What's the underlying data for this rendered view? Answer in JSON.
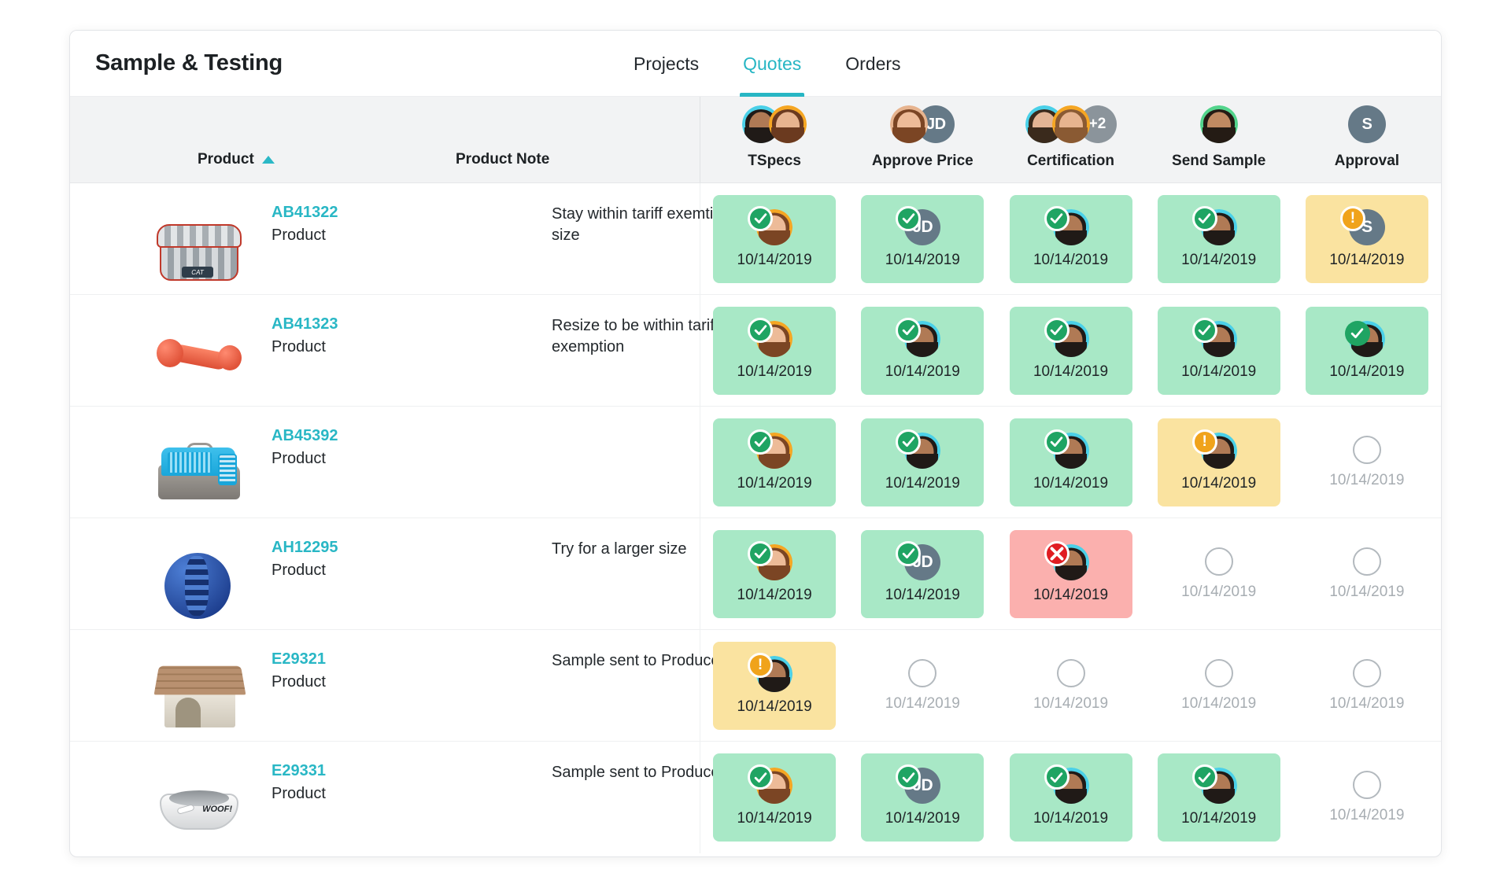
{
  "header": {
    "title": "Sample & Testing",
    "tabs": [
      {
        "label": "Projects",
        "active": false
      },
      {
        "label": "Quotes",
        "active": true
      },
      {
        "label": "Orders",
        "active": false
      }
    ]
  },
  "colors": {
    "accent": "#27b6c4",
    "link": "#29b7c5",
    "approved_bg": "#a8e8c6",
    "pending_bg": "#fae3a0",
    "rejected_bg": "#fbb0ae",
    "badge_ok": "#1fa463",
    "badge_warn": "#f0a31b",
    "badge_no": "#e01c22",
    "avatar_initials_bg": "#657987",
    "avatar_more_bg": "#8b949b",
    "header_bg": "#f2f3f4"
  },
  "table": {
    "left_columns": [
      {
        "label": "Product",
        "sort": "asc",
        "sort_icon": "triangle-up-icon"
      },
      {
        "label": "Product Note",
        "sort": null
      }
    ],
    "status_columns": [
      {
        "label": "TSpecs",
        "avatars": [
          {
            "type": "photo",
            "ring": "#4ad0e8",
            "hair": "#201a17",
            "skin": "#b07a55"
          },
          {
            "type": "photo",
            "ring": "#f5a623",
            "hair": "#6b3a1f",
            "skin": "#e7b48f"
          }
        ]
      },
      {
        "label": "Approve Price",
        "avatars": [
          {
            "type": "photo",
            "ring": "#e7b48f",
            "hair": "#7b4524",
            "skin": "#edbb98"
          },
          {
            "type": "initials",
            "text": "JD"
          }
        ]
      },
      {
        "label": "Certification",
        "avatars": [
          {
            "type": "photo",
            "ring": "#4ad0e8",
            "hair": "#3a2a1c",
            "skin": "#e3b595"
          },
          {
            "type": "photo",
            "ring": "#f5a623",
            "hair": "#8a5a33",
            "skin": "#e7b48f"
          },
          {
            "type": "more",
            "text": "+2"
          }
        ]
      },
      {
        "label": "Send Sample",
        "avatars": [
          {
            "type": "photo",
            "ring": "#53d48c",
            "hair": "#241b14",
            "skin": "#c08a62"
          }
        ]
      },
      {
        "label": "Approval",
        "avatars": [
          {
            "type": "initials",
            "text": "S"
          }
        ]
      }
    ],
    "rows": [
      {
        "thumb": "pet-bed-image",
        "thumb_label": "CAT",
        "code": "AB41322",
        "subtitle": "Product",
        "note": "Stay within tariff exemtion size",
        "menu_icon": "kebab-menu-icon",
        "cells": [
          {
            "state": "approved",
            "date": "10/14/2019",
            "badge": "check",
            "badge_hidden": false,
            "avatar": {
              "type": "photo",
              "ring": "#f5a623",
              "hair": "#7b4524",
              "skin": "#edbb98"
            }
          },
          {
            "state": "approved",
            "date": "10/14/2019",
            "badge": "check",
            "badge_hidden": false,
            "avatar": {
              "type": "initials",
              "text": "JD"
            }
          },
          {
            "state": "approved",
            "date": "10/14/2019",
            "badge": "check",
            "badge_hidden": false,
            "avatar": {
              "type": "photo",
              "ring": "#4ad0e8",
              "hair": "#201a17",
              "skin": "#b07a55"
            }
          },
          {
            "state": "approved",
            "date": "10/14/2019",
            "badge": "check",
            "badge_hidden": false,
            "avatar": {
              "type": "photo",
              "ring": "#4ad0e8",
              "hair": "#201a17",
              "skin": "#b07a55"
            }
          },
          {
            "state": "pending",
            "date": "10/14/2019",
            "badge": "warn",
            "badge_hidden": false,
            "avatar": {
              "type": "initials",
              "text": "S"
            }
          }
        ]
      },
      {
        "thumb": "dog-bone-toy-image",
        "thumb_label": "",
        "code": "AB41323",
        "subtitle": "Product",
        "note": "Resize to be within tariff exemption",
        "menu_icon": "kebab-menu-icon",
        "cells": [
          {
            "state": "approved",
            "date": "10/14/2019",
            "badge": "check",
            "badge_hidden": false,
            "avatar": {
              "type": "photo",
              "ring": "#f5a623",
              "hair": "#7b4524",
              "skin": "#edbb98"
            }
          },
          {
            "state": "approved",
            "date": "10/14/2019",
            "badge": "check",
            "badge_hidden": false,
            "avatar": {
              "type": "photo",
              "ring": "#4ad0e8",
              "hair": "#201a17",
              "skin": "#b07a55"
            }
          },
          {
            "state": "approved",
            "date": "10/14/2019",
            "badge": "check",
            "badge_hidden": false,
            "avatar": {
              "type": "photo",
              "ring": "#4ad0e8",
              "hair": "#201a17",
              "skin": "#b07a55"
            }
          },
          {
            "state": "approved",
            "date": "10/14/2019",
            "badge": "check",
            "badge_hidden": false,
            "avatar": {
              "type": "photo",
              "ring": "#4ad0e8",
              "hair": "#201a17",
              "skin": "#b07a55"
            }
          },
          {
            "state": "approved",
            "date": "10/14/2019",
            "badge": "check",
            "badge_hidden": true,
            "avatar": {
              "type": "photo",
              "ring": "#4ad0e8",
              "hair": "#201a17",
              "skin": "#b07a55"
            }
          }
        ]
      },
      {
        "thumb": "pet-carrier-image",
        "thumb_label": "",
        "code": "AB45392",
        "subtitle": "Product",
        "note": "",
        "menu_icon": "kebab-menu-icon",
        "cells": [
          {
            "state": "approved",
            "date": "10/14/2019",
            "badge": "check",
            "badge_hidden": false,
            "avatar": {
              "type": "photo",
              "ring": "#f5a623",
              "hair": "#7b4524",
              "skin": "#edbb98"
            }
          },
          {
            "state": "approved",
            "date": "10/14/2019",
            "badge": "check",
            "badge_hidden": false,
            "avatar": {
              "type": "photo",
              "ring": "#4ad0e8",
              "hair": "#201a17",
              "skin": "#b07a55"
            }
          },
          {
            "state": "approved",
            "date": "10/14/2019",
            "badge": "check",
            "badge_hidden": false,
            "avatar": {
              "type": "photo",
              "ring": "#4ad0e8",
              "hair": "#201a17",
              "skin": "#b07a55"
            }
          },
          {
            "state": "pending",
            "date": "10/14/2019",
            "badge": "warn",
            "badge_hidden": false,
            "avatar": {
              "type": "photo",
              "ring": "#4ad0e8",
              "hair": "#201a17",
              "skin": "#b07a55"
            }
          },
          {
            "state": "empty",
            "date": "10/14/2019",
            "badge": null,
            "badge_hidden": false,
            "avatar": null
          }
        ]
      },
      {
        "thumb": "treat-ball-image",
        "thumb_label": "",
        "code": "AH12295",
        "subtitle": "Product",
        "note": "Try for a larger size",
        "menu_icon": "kebab-menu-icon",
        "cells": [
          {
            "state": "approved",
            "date": "10/14/2019",
            "badge": "check",
            "badge_hidden": false,
            "avatar": {
              "type": "photo",
              "ring": "#f5a623",
              "hair": "#7b4524",
              "skin": "#edbb98"
            }
          },
          {
            "state": "approved",
            "date": "10/14/2019",
            "badge": "check",
            "badge_hidden": false,
            "avatar": {
              "type": "initials",
              "text": "JD"
            }
          },
          {
            "state": "rejected",
            "date": "10/14/2019",
            "badge": "cross",
            "badge_hidden": false,
            "avatar": {
              "type": "photo",
              "ring": "#4ad0e8",
              "hair": "#201a17",
              "skin": "#b07a55"
            }
          },
          {
            "state": "empty",
            "date": "10/14/2019",
            "badge": null,
            "badge_hidden": false,
            "avatar": null
          },
          {
            "state": "empty",
            "date": "10/14/2019",
            "badge": null,
            "badge_hidden": false,
            "avatar": null
          }
        ]
      },
      {
        "thumb": "dog-house-image",
        "thumb_label": "",
        "code": "E29321",
        "subtitle": "Product",
        "note": "Sample sent to Producer",
        "menu_icon": "kebab-menu-icon",
        "cells": [
          {
            "state": "pending",
            "date": "10/14/2019",
            "badge": "warn",
            "badge_hidden": false,
            "avatar": {
              "type": "photo",
              "ring": "#4ad0e8",
              "hair": "#201a17",
              "skin": "#b07a55"
            }
          },
          {
            "state": "empty",
            "date": "10/14/2019",
            "badge": null,
            "badge_hidden": false,
            "avatar": null
          },
          {
            "state": "empty",
            "date": "10/14/2019",
            "badge": null,
            "badge_hidden": false,
            "avatar": null
          },
          {
            "state": "empty",
            "date": "10/14/2019",
            "badge": null,
            "badge_hidden": false,
            "avatar": null
          },
          {
            "state": "empty",
            "date": "10/14/2019",
            "badge": null,
            "badge_hidden": false,
            "avatar": null
          }
        ]
      },
      {
        "thumb": "dog-bowl-image",
        "thumb_label": "WOOF!",
        "code": "E29331",
        "subtitle": "Product",
        "note": "Sample sent to Producer",
        "menu_icon": "kebab-menu-icon",
        "cells": [
          {
            "state": "approved",
            "date": "10/14/2019",
            "badge": "check",
            "badge_hidden": false,
            "avatar": {
              "type": "photo",
              "ring": "#f5a623",
              "hair": "#7b4524",
              "skin": "#edbb98"
            }
          },
          {
            "state": "approved",
            "date": "10/14/2019",
            "badge": "check",
            "badge_hidden": false,
            "avatar": {
              "type": "initials",
              "text": "JD"
            }
          },
          {
            "state": "approved",
            "date": "10/14/2019",
            "badge": "check",
            "badge_hidden": false,
            "avatar": {
              "type": "photo",
              "ring": "#4ad0e8",
              "hair": "#201a17",
              "skin": "#b07a55"
            }
          },
          {
            "state": "approved",
            "date": "10/14/2019",
            "badge": "check",
            "badge_hidden": false,
            "avatar": {
              "type": "photo",
              "ring": "#4ad0e8",
              "hair": "#201a17",
              "skin": "#b07a55"
            }
          },
          {
            "state": "empty",
            "date": "10/14/2019",
            "badge": null,
            "badge_hidden": false,
            "avatar": null
          }
        ]
      }
    ]
  }
}
